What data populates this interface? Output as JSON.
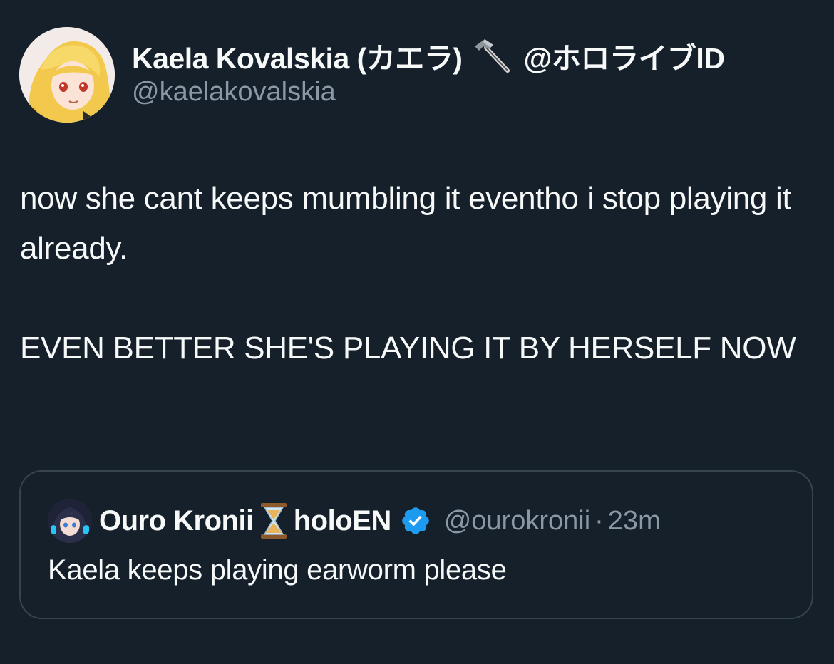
{
  "tweet": {
    "author": {
      "display_name_prefix": "Kaela Kovalskia (カエラ)",
      "display_name_suffix": "@ホロライブID",
      "handle": "@kaelakovalskia",
      "name_icon": "hammer-icon",
      "avatar": "avatar"
    },
    "body": {
      "line1": "now she cant keeps mumbling it eventho i stop playing it already.",
      "line2": "EVEN BETTER SHE'S PLAYING IT BY HERSELF NOW"
    },
    "quoted": {
      "name_part1": "Ouro Kronii",
      "name_icon": "hourglass-icon",
      "name_part2": "holoEN",
      "verified_icon": "verified-badge-icon",
      "handle": "@ourokronii",
      "separator": "·",
      "time": "23m",
      "text": "Kaela keeps playing earworm please"
    }
  },
  "colors": {
    "background": "#15202b",
    "text_primary": "#f7f9f9",
    "text_secondary": "#8b98a5",
    "border": "#38444d",
    "verified": "#1d9bf0"
  }
}
